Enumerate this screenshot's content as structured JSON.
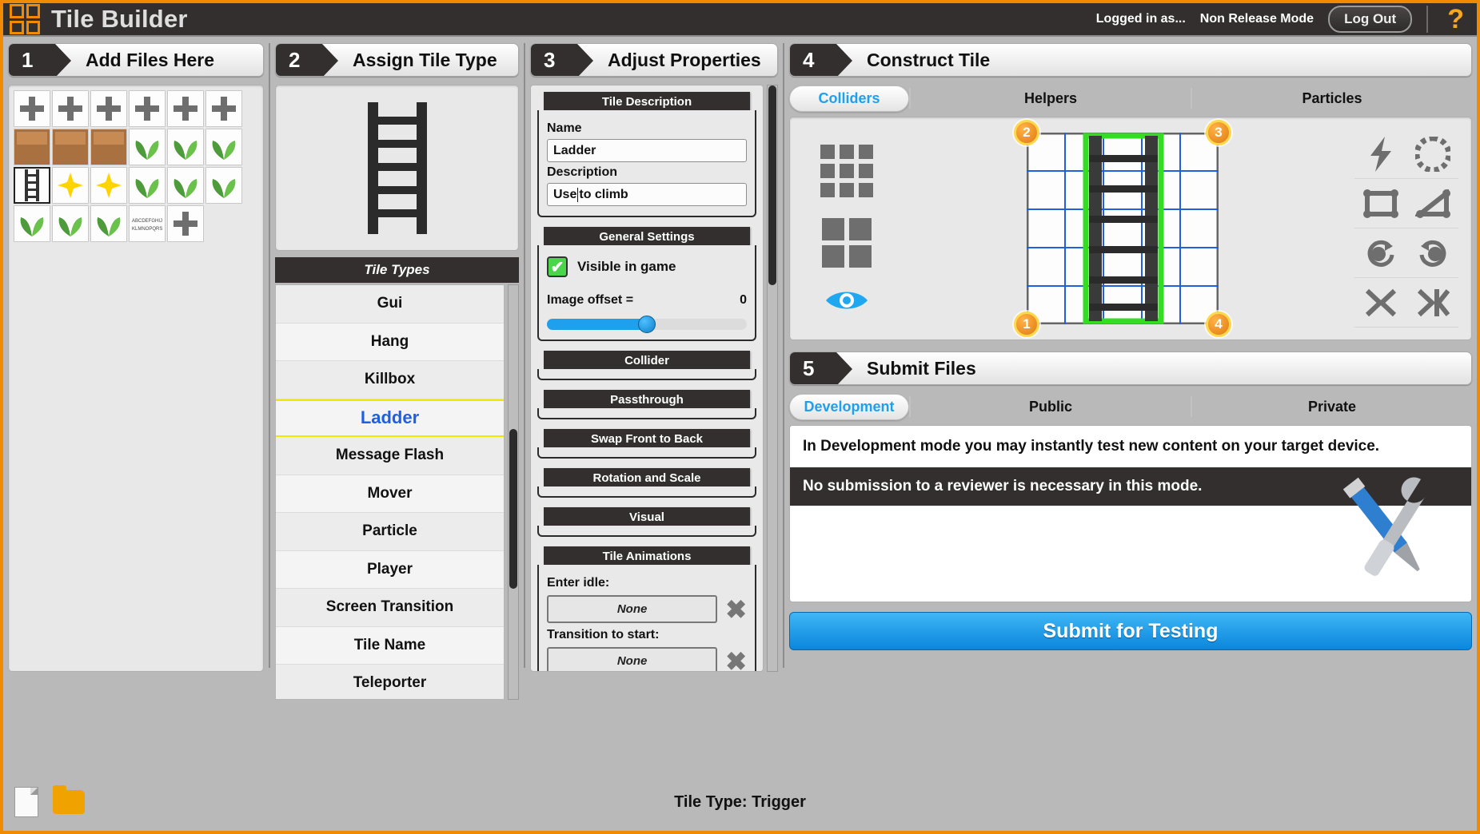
{
  "app": {
    "title": "Tile Builder",
    "logo_icon": "four-squares-logo-icon",
    "accent_color": "#f08a00",
    "logged_in_label": "Logged in as...",
    "mode_label": "Non Release Mode",
    "logout_label": "Log Out",
    "help_icon": "question-mark-icon"
  },
  "steps": {
    "s1": {
      "num": "1",
      "title": "Add Files Here"
    },
    "s2": {
      "num": "2",
      "title": "Assign Tile Type"
    },
    "s3": {
      "num": "3",
      "title": "Adjust Properties"
    },
    "s4": {
      "num": "4",
      "title": "Construct Tile"
    },
    "s5": {
      "num": "5",
      "title": "Submit Files"
    }
  },
  "files": {
    "thumbnails": [
      {
        "name": "plus-sprite",
        "kind": "icon"
      },
      {
        "name": "turret-sprite",
        "kind": "icon"
      },
      {
        "name": "gun-sprite",
        "kind": "icon"
      },
      {
        "name": "cannon-sprite",
        "kind": "icon"
      },
      {
        "name": "soldier-sprite",
        "kind": "icon"
      },
      {
        "name": "sphere-sprite",
        "kind": "icon"
      },
      {
        "name": "crate-brown-tile",
        "kind": "tile"
      },
      {
        "name": "sand-tile",
        "kind": "tile"
      },
      {
        "name": "green-block-tile",
        "kind": "tile"
      },
      {
        "name": "bush-small-sprite",
        "kind": "plant"
      },
      {
        "name": "bush-wide-sprite",
        "kind": "plant"
      },
      {
        "name": "cactus-sprite",
        "kind": "plant"
      },
      {
        "name": "ladder-sprite",
        "kind": "ladder"
      },
      {
        "name": "star-yellow-sprite",
        "kind": "star"
      },
      {
        "name": "spark-sprite",
        "kind": "star"
      },
      {
        "name": "shrub-sprite",
        "kind": "plant"
      },
      {
        "name": "fern-sprite",
        "kind": "plant"
      },
      {
        "name": "grass-tall-sprite",
        "kind": "plant"
      },
      {
        "name": "grass-tuft-sprite",
        "kind": "plant"
      },
      {
        "name": "grass-blades-sprite",
        "kind": "plant"
      },
      {
        "name": "leafy-plant-sprite",
        "kind": "plant"
      },
      {
        "name": "text-sprite",
        "kind": "text"
      },
      {
        "name": "character-sprite",
        "kind": "icon"
      }
    ]
  },
  "tile_types": {
    "preview_icon": "ladder-preview-icon",
    "section_label": "Tile Types",
    "items": [
      {
        "label": "Gui",
        "selected": false
      },
      {
        "label": "Hang",
        "selected": false
      },
      {
        "label": "Killbox",
        "selected": false
      },
      {
        "label": "Ladder",
        "selected": true
      },
      {
        "label": "Message Flash",
        "selected": false
      },
      {
        "label": "Mover",
        "selected": false
      },
      {
        "label": "Particle",
        "selected": false
      },
      {
        "label": "Player",
        "selected": false
      },
      {
        "label": "Screen Transition",
        "selected": false
      },
      {
        "label": "Tile Name",
        "selected": false
      },
      {
        "label": "Teleporter",
        "selected": false
      }
    ]
  },
  "properties": {
    "tile_description": {
      "header": "Tile Description",
      "name_label": "Name",
      "name_value": "Ladder",
      "description_label": "Description",
      "description_value_before_caret": "Use",
      "description_value_after_caret": " to climb"
    },
    "general_settings": {
      "header": "General Settings",
      "visible_label": "Visible in game",
      "visible_checked": true,
      "checkbox_icon": "checkmark-icon",
      "offset_label": "Image offset =",
      "offset_value": "0",
      "offset_percent": 50
    },
    "collapsed_sections": [
      {
        "header": "Collider"
      },
      {
        "header": "Passthrough"
      },
      {
        "header": "Swap Front to Back"
      },
      {
        "header": "Rotation and Scale"
      },
      {
        "header": "Visual"
      }
    ],
    "tile_animations": {
      "header": "Tile Animations",
      "rows": [
        {
          "label": "Enter idle:",
          "value": "None",
          "clear_icon": "x-clear-icon"
        },
        {
          "label": "Transition to start:",
          "value": "None",
          "clear_icon": "x-clear-icon"
        }
      ]
    }
  },
  "construct": {
    "tabs": [
      {
        "label": "Colliders",
        "active": true
      },
      {
        "label": "Helpers",
        "active": false
      },
      {
        "label": "Particles",
        "active": false
      }
    ],
    "left_tools": [
      {
        "name": "grid-3x3-icon"
      },
      {
        "name": "grid-2x2-icon"
      },
      {
        "name": "eye-visibility-icon"
      }
    ],
    "right_tools": [
      {
        "name": "lightning-bolt-icon"
      },
      {
        "name": "polygon-collider-icon"
      },
      {
        "name": "rectangle-collider-icon"
      },
      {
        "name": "triangle-collider-icon"
      },
      {
        "name": "rotate-clockwise-icon"
      },
      {
        "name": "rotate-counterclockwise-icon"
      },
      {
        "name": "flip-horizontal-icon"
      },
      {
        "name": "mirror-icon"
      }
    ],
    "handles": [
      {
        "label": "2",
        "pos": "top-left"
      },
      {
        "label": "3",
        "pos": "top-right"
      },
      {
        "label": "1",
        "pos": "bottom-left"
      },
      {
        "label": "4",
        "pos": "bottom-right"
      }
    ],
    "canvas_icon": "ladder-collider-canvas-icon",
    "collider_color": "#33dd22",
    "grid_color": "#1f5fe0"
  },
  "submit": {
    "tabs": [
      {
        "label": "Development",
        "active": true
      },
      {
        "label": "Public",
        "active": false
      },
      {
        "label": "Private",
        "active": false
      }
    ],
    "info_line": "In Development mode you may instantly test new content on your target device.",
    "info_dark": "No submission to a reviewer is necessary in this mode.",
    "tools_icon": "wrench-screwdriver-icon",
    "button_label": "Submit for Testing"
  },
  "footer": {
    "new_file_icon": "new-file-icon",
    "open_folder_icon": "open-folder-icon",
    "status": "Tile Type: Trigger"
  }
}
